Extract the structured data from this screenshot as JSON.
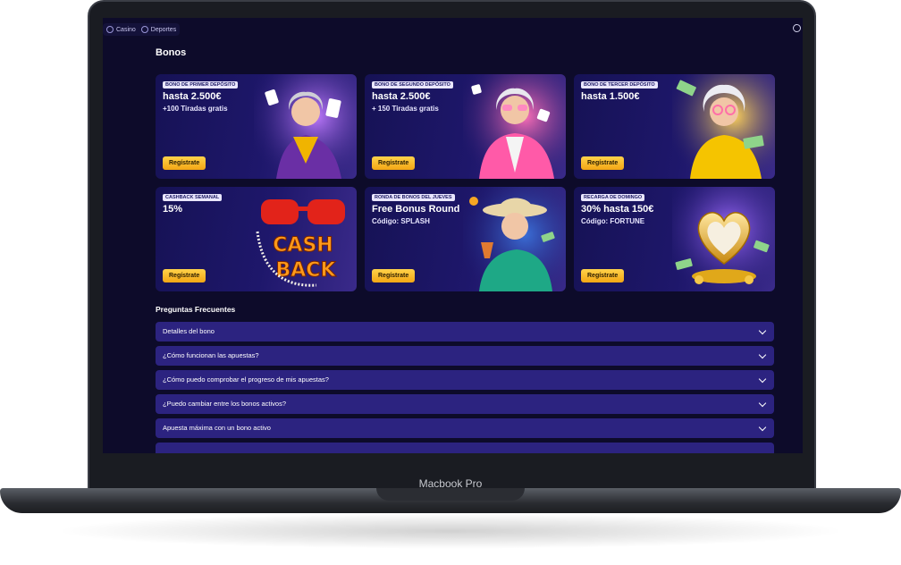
{
  "device": {
    "label": "Macbook Pro"
  },
  "nav": {
    "items": [
      {
        "label": "Casino",
        "icon": "casino-icon"
      },
      {
        "label": "Deportes",
        "icon": "sports-icon"
      }
    ]
  },
  "page": {
    "title": "Bonos"
  },
  "cards": [
    {
      "badge": "BONO DE PRIMER DEPÓSITO",
      "title": "hasta 2.500€",
      "subtitle": "+100 Tiradas gratis",
      "button": "Regístrate",
      "art": "grandma-cards",
      "accent": "#7a3fbf"
    },
    {
      "badge": "BONO DE SEGUNDO DEPÓSITO",
      "title": "hasta 2.500€",
      "subtitle": "+ 150 Tiradas gratis",
      "button": "Regístrate",
      "art": "grandma-pink-coat",
      "accent": "#d84a9a"
    },
    {
      "badge": "BONO DE TERCER DEPÓSITO",
      "title": "hasta 1.500€",
      "subtitle": "",
      "button": "Regístrate",
      "art": "grandma-money",
      "accent": "#f0b400"
    },
    {
      "badge": "CASHBACK SEMANAL",
      "title": "15%",
      "subtitle": "",
      "button": "Regístrate",
      "art": "cashback-glasses",
      "accent": "#ff7a1a"
    },
    {
      "badge": "RONDA DE BONOS DEL JUEVES",
      "title": "Free Bonus Round",
      "subtitle": "Código: SPLASH",
      "button": "Regístrate",
      "art": "grandma-drink",
      "accent": "#2bb39a"
    },
    {
      "badge": "RECARGA DE DOMINGO",
      "title": "30% hasta 150€",
      "subtitle": "Código: FORTUNE",
      "button": "Regístrate",
      "art": "golden-heart",
      "accent": "#e0a81a"
    }
  ],
  "faq": {
    "title": "Preguntas Frecuentes",
    "items": [
      "Detalles del bono",
      "¿Cómo funcionan las apuestas?",
      "¿Cómo puedo comprobar el progreso de mis apuestas?",
      "¿Puedo cambiar entre los bonos activos?",
      "Apuesta máxima con un bono activo"
    ]
  }
}
